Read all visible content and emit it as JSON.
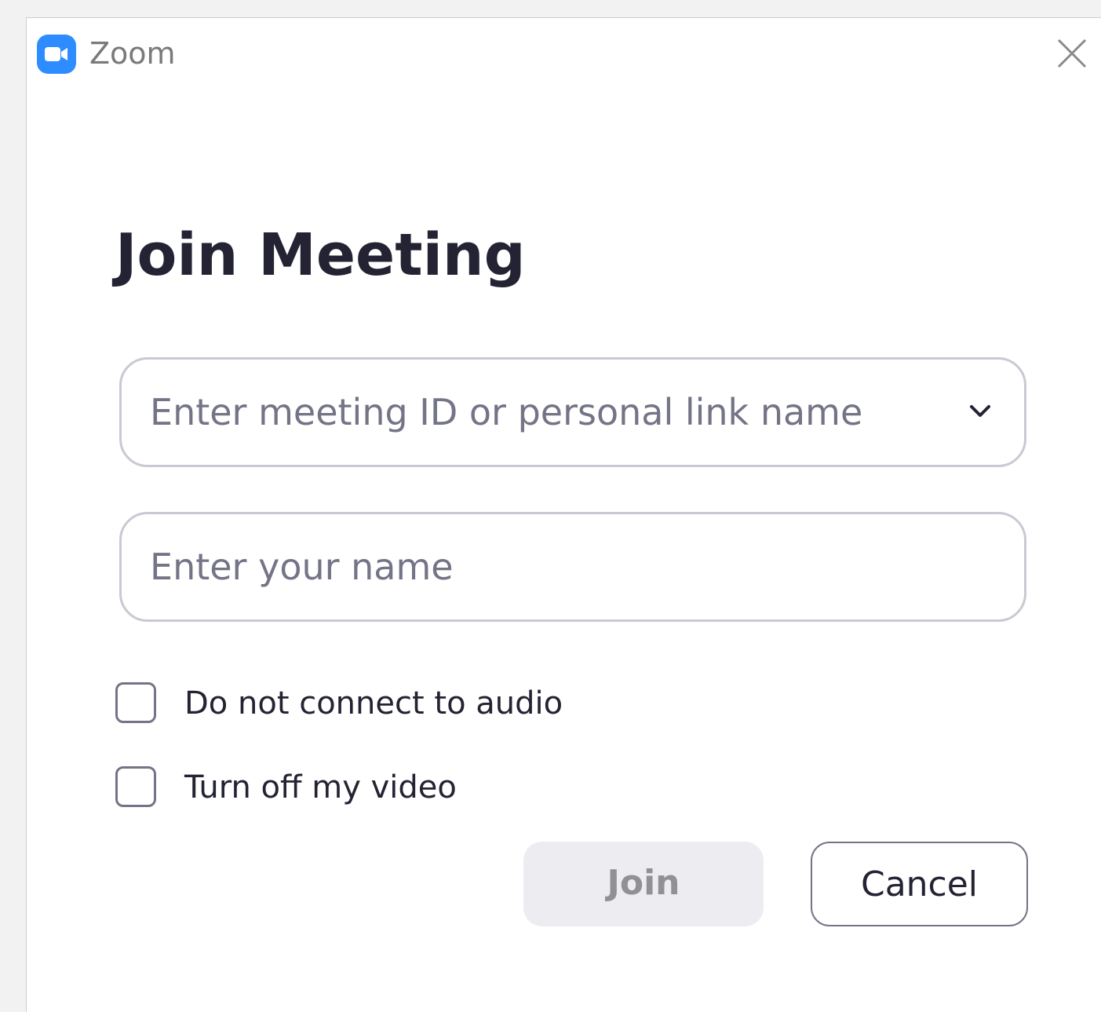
{
  "window": {
    "title": "Zoom",
    "app_icon": "zoom-camera-icon",
    "close_icon": "close-icon",
    "brand_color": "#2d8cff"
  },
  "dialog": {
    "heading": "Join Meeting",
    "meeting_field": {
      "value": "",
      "placeholder": "Enter meeting ID or personal link name",
      "dropdown_icon": "chevron-down-icon"
    },
    "name_field": {
      "value": "",
      "placeholder": "Enter your name"
    },
    "options": {
      "no_audio": {
        "label": "Do not connect to audio",
        "checked": false
      },
      "video_off": {
        "label": "Turn off my video",
        "checked": false
      }
    },
    "buttons": {
      "join_label": "Join",
      "join_enabled": false,
      "cancel_label": "Cancel"
    }
  }
}
